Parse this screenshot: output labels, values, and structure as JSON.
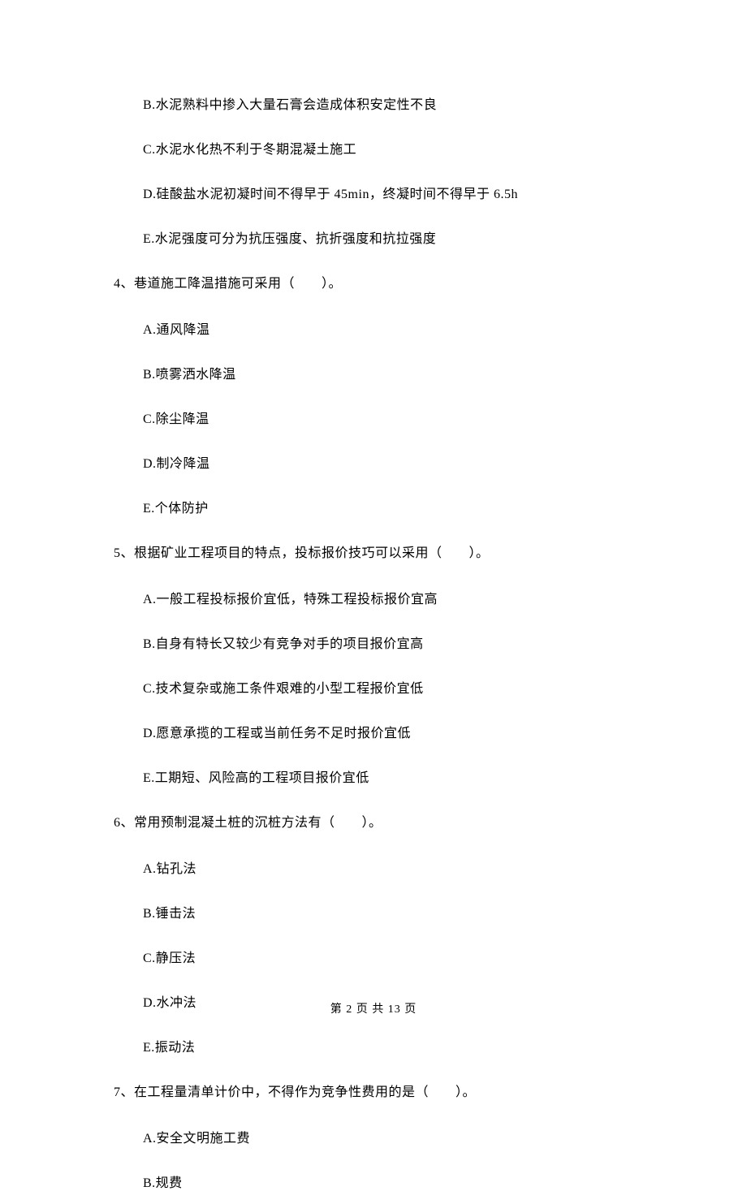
{
  "q3": {
    "options": {
      "b": "B.水泥熟料中掺入大量石膏会造成体积安定性不良",
      "c": "C.水泥水化热不利于冬期混凝土施工",
      "d": "D.硅酸盐水泥初凝时间不得早于 45min，终凝时间不得早于 6.5h",
      "e": "E.水泥强度可分为抗压强度、抗折强度和抗拉强度"
    }
  },
  "q4": {
    "stem": "4、巷道施工降温措施可采用（　　）。",
    "options": {
      "a": "A.通风降温",
      "b": "B.喷雾洒水降温",
      "c": "C.除尘降温",
      "d": "D.制冷降温",
      "e": "E.个体防护"
    }
  },
  "q5": {
    "stem": "5、根据矿业工程项目的特点，投标报价技巧可以采用（　　）。",
    "options": {
      "a": "A.一般工程投标报价宜低，特殊工程投标报价宜高",
      "b": "B.自身有特长又较少有竞争对手的项目报价宜高",
      "c": "C.技术复杂或施工条件艰难的小型工程报价宜低",
      "d": "D.愿意承揽的工程或当前任务不足时报价宜低",
      "e": "E.工期短、风险高的工程项目报价宜低"
    }
  },
  "q6": {
    "stem": "6、常用预制混凝土桩的沉桩方法有（　　）。",
    "options": {
      "a": "A.钻孔法",
      "b": "B.锤击法",
      "c": "C.静压法",
      "d": "D.水冲法",
      "e": "E.振动法"
    }
  },
  "q7": {
    "stem": "7、在工程量清单计价中，不得作为竞争性费用的是（　　）。",
    "options": {
      "a": "A.安全文明施工费",
      "b": "B.规费"
    }
  },
  "footer": "第 2 页 共 13 页"
}
